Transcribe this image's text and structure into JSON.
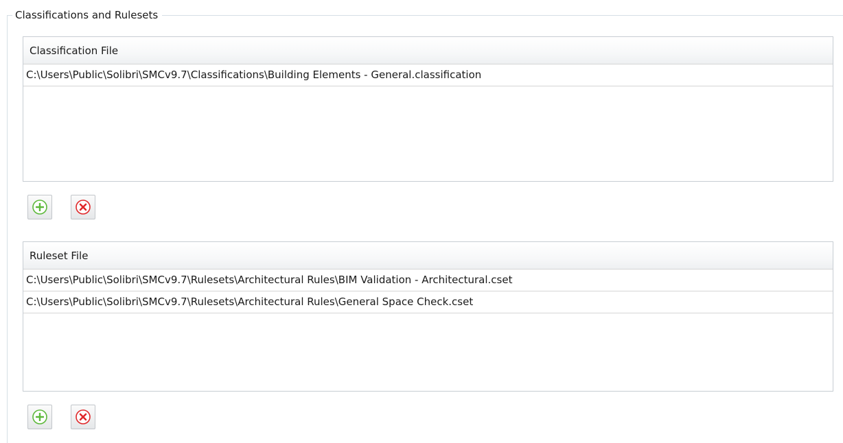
{
  "group": {
    "title": "Classifications and Rulesets"
  },
  "classification": {
    "header": "Classification File",
    "rows": [
      "C:\\Users\\Public\\Solibri\\SMCv9.7\\Classifications\\Building Elements - General.classification"
    ],
    "add_icon": "add-icon",
    "remove_icon": "remove-icon"
  },
  "ruleset": {
    "header": "Ruleset File",
    "rows": [
      "C:\\Users\\Public\\Solibri\\SMCv9.7\\Rulesets\\Architectural Rules\\BIM Validation - Architectural.cset",
      "C:\\Users\\Public\\Solibri\\SMCv9.7\\Rulesets\\Architectural Rules\\General Space Check.cset"
    ],
    "add_icon": "add-icon",
    "remove_icon": "remove-icon"
  },
  "colors": {
    "add": "#5cb83a",
    "remove": "#e0282a"
  }
}
